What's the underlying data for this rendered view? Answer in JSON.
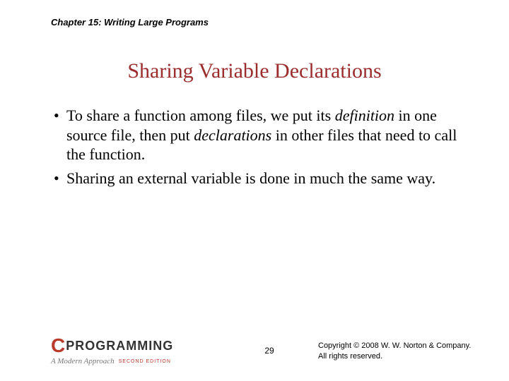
{
  "chapter_label": "Chapter 15: Writing Large Programs",
  "slide_title": "Sharing Variable Declarations",
  "bullets": [
    {
      "pre": "To share a function among files, we put its ",
      "em1": "definition",
      "mid": " in one source file, then put ",
      "em2": "declarations",
      "post": " in other files that need to call the function."
    },
    {
      "pre": "Sharing an external variable is done in much the same way.",
      "em1": "",
      "mid": "",
      "em2": "",
      "post": ""
    }
  ],
  "logo": {
    "c": "C",
    "prog": "PROGRAMMING",
    "sub": "A Modern Approach",
    "edition": "SECOND EDITION"
  },
  "page_number": "29",
  "copyright_line1": "Copyright © 2008 W. W. Norton & Company.",
  "copyright_line2": "All rights reserved."
}
